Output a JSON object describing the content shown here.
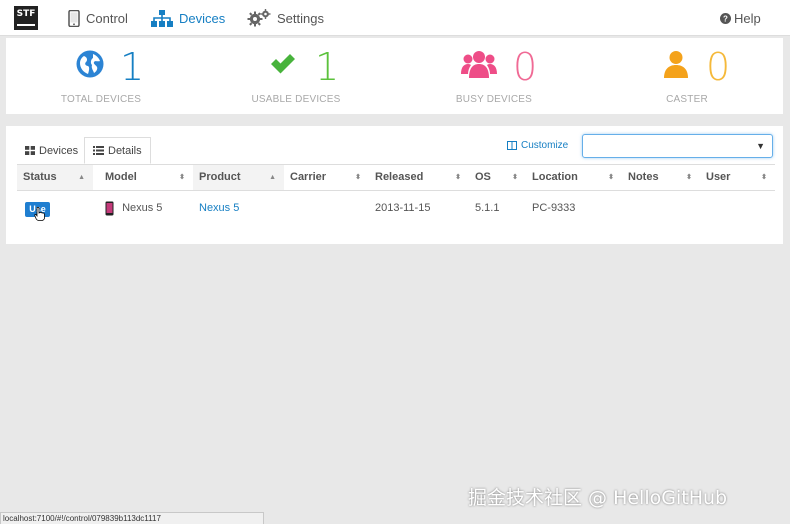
{
  "nav": {
    "logo_text": "STF",
    "items": [
      {
        "label": "Control",
        "icon": "phone-icon"
      },
      {
        "label": "Devices",
        "icon": "sitemap-icon",
        "active": true
      },
      {
        "label": "Settings",
        "icon": "gears-icon"
      }
    ],
    "help_label": "Help"
  },
  "stats": [
    {
      "value": "1",
      "label": "TOTAL DEVICES",
      "icon": "globe-icon",
      "color": "#167fc3",
      "icon_color": "#2c84d4"
    },
    {
      "value": "1",
      "label": "USABLE DEVICES",
      "icon": "check-icon",
      "color": "#5cc23c",
      "icon_color": "#48b33c"
    },
    {
      "value": "0",
      "label": "BUSY DEVICES",
      "icon": "users-icon",
      "color": "#f06a95",
      "icon_color": "#ee4d87"
    },
    {
      "value": "0",
      "label": "CASTER",
      "icon": "user-icon",
      "color": "#f5b93a",
      "icon_color": "#f4a21b"
    }
  ],
  "tabs": [
    {
      "label": "Devices",
      "icon": "grid-icon"
    },
    {
      "label": "Details",
      "icon": "list-icon",
      "active": true
    }
  ],
  "customize_label": "Customize",
  "search": {
    "value": "",
    "placeholder": ""
  },
  "table": {
    "columns": [
      "Status",
      "Model",
      "Product",
      "Carrier",
      "Released",
      "OS",
      "Location",
      "Notes",
      "User"
    ],
    "rows": [
      {
        "status": "Use",
        "model": "Nexus 5",
        "product": "Nexus 5",
        "carrier": "",
        "released": "2013-11-15",
        "os": "5.1.1",
        "location": "PC-9333",
        "notes": "",
        "user": ""
      }
    ]
  },
  "status_url": "localhost:7100/#!/control/079839b113dc1117",
  "watermark": "掘金技术社区 @ HelloGitHub"
}
